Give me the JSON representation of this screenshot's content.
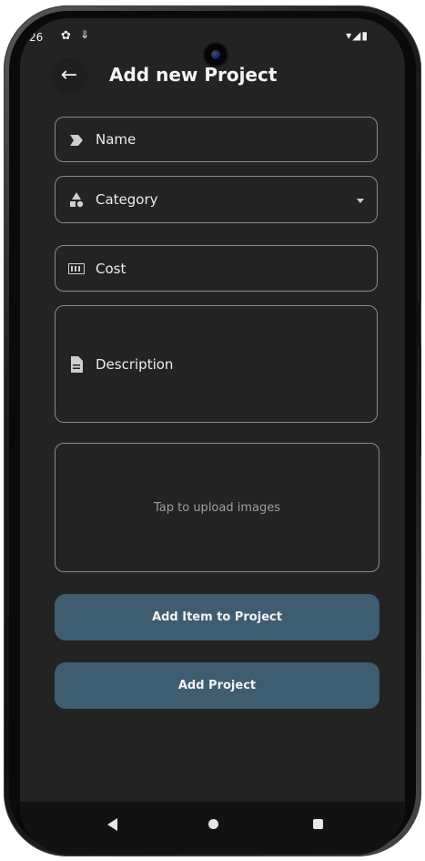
{
  "status_bar": {
    "time": ":26",
    "gear_icon": "gear-icon",
    "download_icon": "download-icon",
    "right_icons": "▾◢▮"
  },
  "appbar": {
    "back_glyph": "←",
    "title": "Add new Project"
  },
  "form": {
    "name_label": "Name",
    "category_label": "Category",
    "cost_label": "Cost",
    "description_label": "Description",
    "upload_hint": "Tap to upload images"
  },
  "buttons": {
    "add_item_label": "Add Item to Project",
    "add_project_label": "Add Project"
  },
  "colors": {
    "background": "#232323",
    "button": "#3e5d71",
    "outline": "#8a8a8a"
  }
}
